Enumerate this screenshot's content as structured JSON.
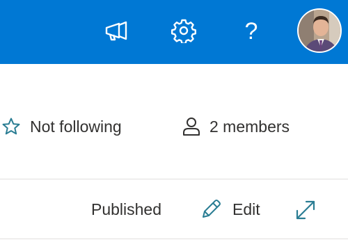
{
  "header": {
    "icons": [
      "megaphone-icon",
      "gear-icon",
      "help-icon"
    ],
    "help_label": "?",
    "avatar": "user-avatar",
    "bar_color": "#0078d4"
  },
  "meta": {
    "follow_label": "Not following",
    "members_label": "2 members"
  },
  "page_status": {
    "status_label": "Published",
    "edit_label": "Edit"
  },
  "colors": {
    "icon_teal": "#2a7d93",
    "text": "#323130"
  }
}
